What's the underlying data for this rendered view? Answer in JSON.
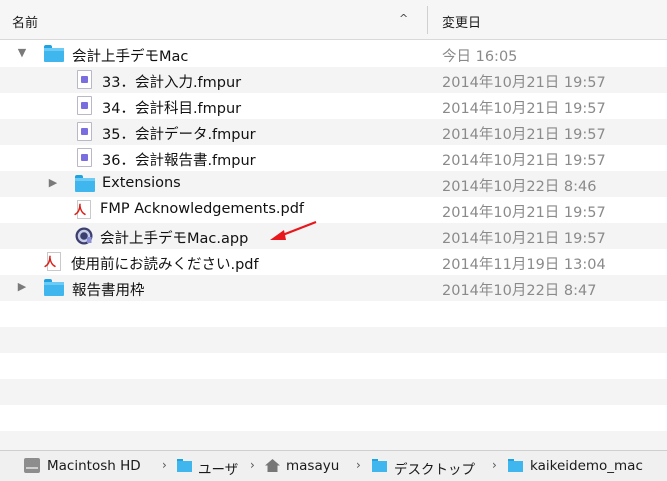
{
  "header": {
    "name_label": "名前",
    "sort_glyph": "^",
    "date_label": "変更日"
  },
  "rows": [
    {
      "name": "会計上手デモMac",
      "date": "今日 16:05"
    },
    {
      "name": "33．会計入力.fmpur",
      "date": "2014年10月21日 19:57"
    },
    {
      "name": "34．会計科目.fmpur",
      "date": "2014年10月21日 19:57"
    },
    {
      "name": "35．会計データ.fmpur",
      "date": "2014年10月21日 19:57"
    },
    {
      "name": "36．会計報告書.fmpur",
      "date": "2014年10月21日 19:57"
    },
    {
      "name": "Extensions",
      "date": "2014年10月22日 8:46"
    },
    {
      "name": "FMP Acknowledgements.pdf",
      "date": "2014年10月21日 19:57"
    },
    {
      "name": "会計上手デモMac.app",
      "date": "2014年10月21日 19:57"
    },
    {
      "name": "使用前にお読みください.pdf",
      "date": "2014年11月19日 13:04"
    },
    {
      "name": "報告書用枠",
      "date": "2014年10月22日 8:47"
    }
  ],
  "pathbar": {
    "items": [
      "Macintosh HD",
      "ユーザ",
      "masayu",
      "デスクトップ",
      "kaikeidemo_mac"
    ],
    "separator": "›"
  },
  "colors": {
    "folder": "#3fb6ee",
    "pdf_red": "#d8221b",
    "annotation_arrow": "#e8161d",
    "date_text": "#8a8a8a"
  },
  "glyphs": {
    "expanded": "▼",
    "collapsed": "▶"
  }
}
